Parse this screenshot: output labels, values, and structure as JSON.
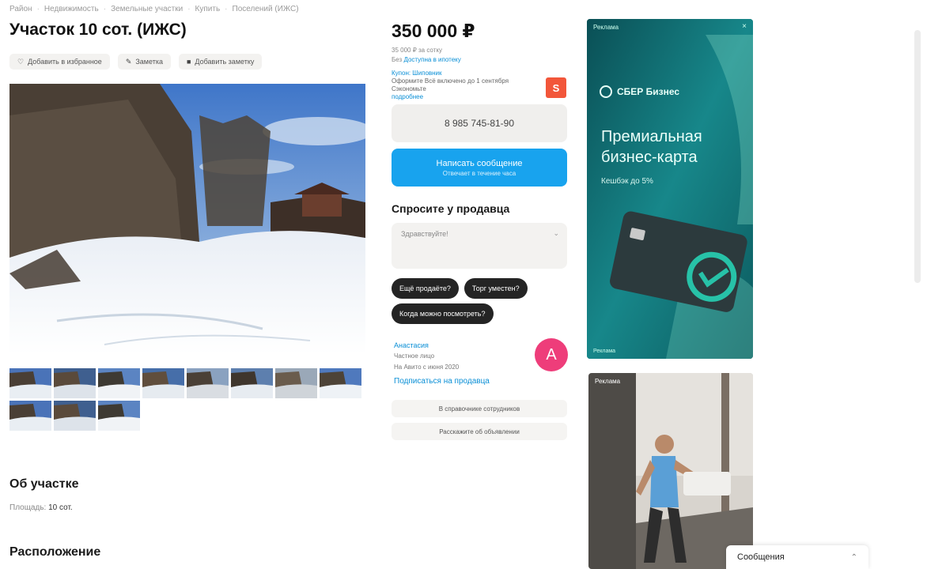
{
  "breadcrumbs": [
    "Район",
    "Недвижимость",
    "Земельные участки",
    "Купить",
    "Поселений (ИЖС)"
  ],
  "listing": {
    "title": "Участок 10 сот. (ИЖС)",
    "actions": [
      {
        "icon": "heart-icon",
        "glyph": "♡",
        "label": "Добавить в избранное"
      },
      {
        "icon": "note-icon",
        "glyph": "✎",
        "label": "Заметка"
      },
      {
        "icon": "compare-icon",
        "glyph": "■",
        "label": "Добавить заметку"
      }
    ],
    "thumb_count": 11
  },
  "price": {
    "amount": "350 000 ₽",
    "per_unit": "35 000 ₽ за сотку",
    "mortgage_text": "Без",
    "mortgage_link": "Доступна в ипотеку",
    "promo_label": "Купон: Шиповник",
    "promo_text": "Оформите Всё включено до 1 сентября Сэкономьте",
    "promo_link": "подробнее",
    "promo_badge": "S"
  },
  "contact": {
    "phone": "8 985 745-81-90",
    "message_label": "Написать сообщение",
    "message_sub": "Отвечает в течение часа"
  },
  "ask": {
    "title": "Спросите у продавца",
    "placeholder": "Здравствуйте!",
    "chips": [
      "Ещё продаёте?",
      "Торг уместен?",
      "Когда можно посмотреть?"
    ]
  },
  "seller": {
    "name": "Анастасия",
    "type": "Частное лицо",
    "since": "На Авито с июня 2020",
    "link": "Подписаться на продавца",
    "avatar_letter": "А",
    "btn_contacts": "В справочнике сотрудников",
    "btn_other": "Расскажите об объявлении"
  },
  "about": {
    "title": "Об участке",
    "area_label": "Площадь:",
    "area_value": "10 сот."
  },
  "location": {
    "title": "Расположение"
  },
  "ad1": {
    "tag": "Реклама",
    "close": "×",
    "brand": "СБЕР Бизнес",
    "headline": "Премиальная бизнес-карта",
    "subline": "Кешбэк до 5%",
    "foot": "Реклама"
  },
  "ad2": {
    "tag": "Реклама"
  },
  "messages_bar": {
    "label": "Сообщения",
    "chevron": "⌃"
  },
  "colors": {
    "accent_blue": "#18a3ee",
    "avatar_pink": "#ee3d7a",
    "promo_red": "#f2563a",
    "ad_teal": "#0d5f63"
  }
}
